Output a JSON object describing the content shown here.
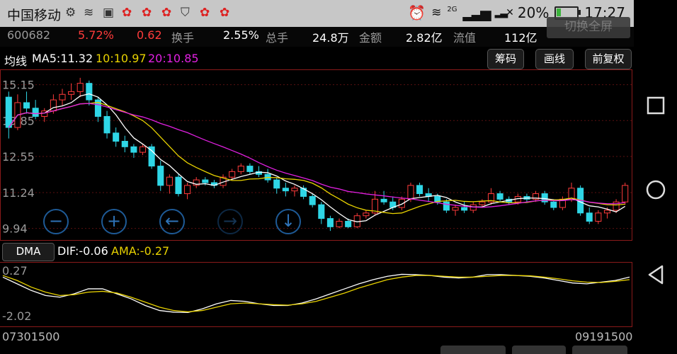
{
  "status_bar": {
    "carrier": "中国移动",
    "network": "2G",
    "battery": "20%",
    "battery_level": 0.2,
    "time": "17:27"
  },
  "info_bar": {
    "code": "600682",
    "change_pct": "5.72%",
    "change": "0.62",
    "turnover_label": "换手",
    "turnover": "2.55%",
    "volume_label": "总手",
    "volume": "24.8万",
    "amount_label": "金额",
    "amount": "2.82亿",
    "float_label": "流值",
    "float_value": "112亿",
    "fullscreen_button": "切换全屏"
  },
  "ma_bar": {
    "label": "均线",
    "ma5": "MA5:11.32",
    "ma10": "10:10.97",
    "ma20": "20:10.85",
    "buttons": [
      "筹码",
      "画线",
      "前复权"
    ]
  },
  "colors": {
    "up": "#ff3b3b",
    "down": "#2fd6e6",
    "ma5": "#ffffff",
    "ma10": "#e8d200",
    "ma20": "#e020e0"
  },
  "controls": [
    "minus-circle-icon",
    "plus-circle-icon",
    "arrow-left-circle-icon",
    "arrow-right-circle-icon",
    "arrow-down-circle-icon"
  ],
  "dma_bar": {
    "button": "DMA",
    "dif": "DIF:-0.06",
    "ama": "AMA:-0.27"
  },
  "dates": {
    "start": "07301500",
    "end": "09191500"
  },
  "chart_data": {
    "type": "candlestick",
    "price_axis_labels": [
      "15.15",
      "13.85",
      "12.55",
      "11.24",
      "9.94"
    ],
    "price_axis_values": [
      15.15,
      13.85,
      12.55,
      11.24,
      9.94
    ],
    "ylim": [
      9.7,
      15.5
    ],
    "candles": [
      [
        14.7,
        14.9,
        13.2,
        13.6
      ],
      [
        13.6,
        14.8,
        13.5,
        14.5
      ],
      [
        14.5,
        14.9,
        14.1,
        14.3
      ],
      [
        14.3,
        14.6,
        13.9,
        14.0
      ],
      [
        14.0,
        14.3,
        13.8,
        14.2
      ],
      [
        14.2,
        14.8,
        14.1,
        14.6
      ],
      [
        14.6,
        15.0,
        14.4,
        14.8
      ],
      [
        14.8,
        15.2,
        14.6,
        14.9
      ],
      [
        14.9,
        15.4,
        14.7,
        15.2
      ],
      [
        15.2,
        15.3,
        14.4,
        14.6
      ],
      [
        14.6,
        14.7,
        13.8,
        14.0
      ],
      [
        14.0,
        14.2,
        13.2,
        13.4
      ],
      [
        13.4,
        13.6,
        12.9,
        13.1
      ],
      [
        13.1,
        13.3,
        12.7,
        12.9
      ],
      [
        12.9,
        13.0,
        12.5,
        12.7
      ],
      [
        12.7,
        13.0,
        12.6,
        12.9
      ],
      [
        12.9,
        13.0,
        12.1,
        12.2
      ],
      [
        12.2,
        12.4,
        11.3,
        11.5
      ],
      [
        11.5,
        11.9,
        11.2,
        11.8
      ],
      [
        11.8,
        11.9,
        11.1,
        11.2
      ],
      [
        11.2,
        11.6,
        11.0,
        11.5
      ],
      [
        11.5,
        11.8,
        11.4,
        11.7
      ],
      [
        11.7,
        11.8,
        11.5,
        11.6
      ],
      [
        11.6,
        11.7,
        11.4,
        11.5
      ],
      [
        11.5,
        11.9,
        11.4,
        11.8
      ],
      [
        11.8,
        12.1,
        11.7,
        12.0
      ],
      [
        12.0,
        12.3,
        11.9,
        12.2
      ],
      [
        12.2,
        12.3,
        11.9,
        12.0
      ],
      [
        12.0,
        12.2,
        11.8,
        11.9
      ],
      [
        11.9,
        12.1,
        11.6,
        11.7
      ],
      [
        11.7,
        11.8,
        11.2,
        11.4
      ],
      [
        11.4,
        11.6,
        11.1,
        11.3
      ],
      [
        11.3,
        11.5,
        11.1,
        11.4
      ],
      [
        11.4,
        11.5,
        11.0,
        11.1
      ],
      [
        11.1,
        11.2,
        10.7,
        10.8
      ],
      [
        10.8,
        10.9,
        10.1,
        10.3
      ],
      [
        10.3,
        10.4,
        9.85,
        10.0
      ],
      [
        10.0,
        10.3,
        9.95,
        10.2
      ],
      [
        10.2,
        10.3,
        9.95,
        10.0
      ],
      [
        10.0,
        10.5,
        9.95,
        10.4
      ],
      [
        10.4,
        10.6,
        10.3,
        10.5
      ],
      [
        10.5,
        11.3,
        10.4,
        11.0
      ],
      [
        11.0,
        11.3,
        10.8,
        10.9
      ],
      [
        10.9,
        11.1,
        10.6,
        10.7
      ],
      [
        10.7,
        11.1,
        10.6,
        11.0
      ],
      [
        11.0,
        11.6,
        10.9,
        11.5
      ],
      [
        11.5,
        11.6,
        11.1,
        11.2
      ],
      [
        11.2,
        11.4,
        10.9,
        11.1
      ],
      [
        11.1,
        11.2,
        10.8,
        10.9
      ],
      [
        10.9,
        11.0,
        10.5,
        10.6
      ],
      [
        10.6,
        10.8,
        10.4,
        10.7
      ],
      [
        10.7,
        10.9,
        10.5,
        10.6
      ],
      [
        10.6,
        10.9,
        10.5,
        10.8
      ],
      [
        10.8,
        11.0,
        10.7,
        10.9
      ],
      [
        10.9,
        11.4,
        10.8,
        11.2
      ],
      [
        11.2,
        11.3,
        10.9,
        11.0
      ],
      [
        11.0,
        11.1,
        10.8,
        10.9
      ],
      [
        10.9,
        11.2,
        10.8,
        11.1
      ],
      [
        11.1,
        11.2,
        10.9,
        11.0
      ],
      [
        11.0,
        11.3,
        10.9,
        11.2
      ],
      [
        11.2,
        11.3,
        10.8,
        10.9
      ],
      [
        10.9,
        11.0,
        10.6,
        10.7
      ],
      [
        10.7,
        11.1,
        10.6,
        11.0
      ],
      [
        11.0,
        11.6,
        10.9,
        11.4
      ],
      [
        11.4,
        11.5,
        10.4,
        10.5
      ],
      [
        10.5,
        10.7,
        10.1,
        10.2
      ],
      [
        10.2,
        10.6,
        10.1,
        10.5
      ],
      [
        10.5,
        10.7,
        10.3,
        10.6
      ],
      [
        10.6,
        11.0,
        10.5,
        10.9
      ],
      [
        10.9,
        11.6,
        10.8,
        11.5
      ]
    ],
    "dma_labels": [
      "0.27",
      "-2.02"
    ],
    "dma_ylim": [
      -2.3,
      0.5
    ],
    "dif": [
      0.1,
      -0.3,
      -0.7,
      -1.0,
      -1.1,
      -0.9,
      -0.6,
      -0.6,
      -0.9,
      -1.2,
      -1.6,
      -1.9,
      -2.0,
      -2.02,
      -1.8,
      -1.5,
      -1.3,
      -1.35,
      -1.5,
      -1.6,
      -1.6,
      -1.45,
      -1.2,
      -0.9,
      -0.6,
      -0.3,
      -0.05,
      0.15,
      0.27,
      0.25,
      0.2,
      0.1,
      0.05,
      0.1,
      0.25,
      0.25,
      0.2,
      0.15,
      0.05,
      -0.1,
      -0.25,
      -0.3,
      -0.2,
      -0.1,
      0.1
    ],
    "ama": [
      0.2,
      -0.1,
      -0.5,
      -0.8,
      -1.0,
      -0.95,
      -0.8,
      -0.75,
      -0.85,
      -1.1,
      -1.4,
      -1.7,
      -1.9,
      -1.98,
      -1.9,
      -1.7,
      -1.5,
      -1.45,
      -1.5,
      -1.55,
      -1.58,
      -1.5,
      -1.35,
      -1.1,
      -0.85,
      -0.55,
      -0.3,
      -0.05,
      0.1,
      0.2,
      0.2,
      0.15,
      0.1,
      0.1,
      0.15,
      0.2,
      0.2,
      0.18,
      0.1,
      0.0,
      -0.12,
      -0.2,
      -0.22,
      -0.15,
      -0.05
    ]
  }
}
